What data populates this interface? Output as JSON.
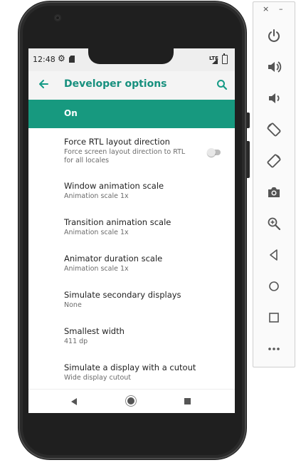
{
  "status_bar": {
    "time": "12:48",
    "network_label": "LTE"
  },
  "app_bar": {
    "title": "Developer options"
  },
  "master_switch": {
    "label": "On"
  },
  "settings": [
    {
      "title": "Force RTL layout direction",
      "summary": "Force screen layout direction to RTL for all locales",
      "toggle": false
    },
    {
      "title": "Window animation scale",
      "summary": "Animation scale 1x"
    },
    {
      "title": "Transition animation scale",
      "summary": "Animation scale 1x"
    },
    {
      "title": "Animator duration scale",
      "summary": "Animation scale 1x"
    },
    {
      "title": "Simulate secondary displays",
      "summary": "None"
    },
    {
      "title": "Smallest width",
      "summary": "411 dp"
    },
    {
      "title": "Simulate a display with a cutout",
      "summary": "Wide display cutout"
    }
  ],
  "toolbar": {
    "close_label": "×",
    "minimize_label": "–",
    "buttons": [
      "power-icon",
      "volume-up-icon",
      "volume-down-icon",
      "rotate-left-icon",
      "rotate-right-icon",
      "camera-icon",
      "zoom-icon",
      "back-icon",
      "home-icon",
      "overview-icon",
      "more-icon"
    ]
  },
  "colors": {
    "accent": "#17997f",
    "title": "#17907e",
    "phone_body": "#2a2a2a"
  }
}
